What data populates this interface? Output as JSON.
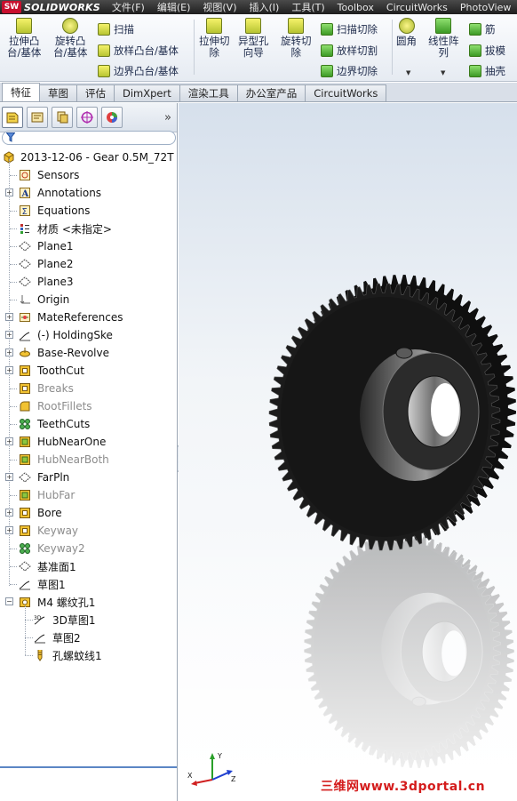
{
  "app": {
    "logo_mark": "SW",
    "logo_text": "SOLIDWORKS"
  },
  "menu": [
    "文件(F)",
    "编辑(E)",
    "视图(V)",
    "插入(I)",
    "工具(T)",
    "Toolbox",
    "CircuitWorks",
    "PhotoView"
  ],
  "ribbon": {
    "extrude_boss": [
      "拉伸凸",
      "台/基体"
    ],
    "revolve_boss": [
      "旋转凸",
      "台/基体"
    ],
    "sweep": "扫描",
    "loft_boss": "放样凸台/基体",
    "boundary_boss": "边界凸台/基体",
    "extrude_cut": [
      "拉伸切",
      "除"
    ],
    "hole_wizard": [
      "异型孔",
      "向导"
    ],
    "revolve_cut": [
      "旋转切",
      "除"
    ],
    "swept_cut": "扫描切除",
    "lofted_cut": "放样切割",
    "boundary_cut": "边界切除",
    "fillet": "圆角",
    "linear_pattern": [
      "线性阵",
      "列"
    ],
    "rib": "筋",
    "draft": "拔模",
    "shell": "抽壳"
  },
  "tabs": [
    "特征",
    "草图",
    "评估",
    "DimXpert",
    "渲染工具",
    "办公室产品",
    "CircuitWorks"
  ],
  "active_tab": "特征",
  "panel": {
    "more": "»"
  },
  "tree": {
    "root": "2013-12-06 - Gear 0.5M_72T",
    "items": [
      {
        "label": "Sensors",
        "icon": "sensor-icon",
        "dim": false
      },
      {
        "label": "Annotations",
        "icon": "annotation-icon",
        "dim": false
      },
      {
        "label": "Equations",
        "icon": "equation-icon",
        "dim": false
      },
      {
        "label": "材质 <未指定>",
        "icon": "material-icon",
        "dim": false
      },
      {
        "label": "Plane1",
        "icon": "plane-icon",
        "dim": false
      },
      {
        "label": "Plane2",
        "icon": "plane-icon",
        "dim": false
      },
      {
        "label": "Plane3",
        "icon": "plane-icon",
        "dim": false
      },
      {
        "label": "Origin",
        "icon": "origin-icon",
        "dim": false
      },
      {
        "label": "MateReferences",
        "icon": "mate-reference-icon",
        "dim": false
      },
      {
        "label": "(-) HoldingSke",
        "icon": "sketch-icon",
        "dim": false
      },
      {
        "label": "Base-Revolve",
        "icon": "revolve-icon",
        "dim": false
      },
      {
        "label": "ToothCut",
        "icon": "cut-icon",
        "dim": false
      },
      {
        "label": "Breaks",
        "icon": "cut-icon",
        "dim": true
      },
      {
        "label": "RootFillets",
        "icon": "fillet-icon",
        "dim": true
      },
      {
        "label": "TeethCuts",
        "icon": "pattern-icon",
        "dim": false
      },
      {
        "label": "HubNearOne",
        "icon": "boss-icon",
        "dim": false
      },
      {
        "label": "HubNearBoth",
        "icon": "boss-icon",
        "dim": true
      },
      {
        "label": "FarPln",
        "icon": "plane-icon",
        "dim": false
      },
      {
        "label": "HubFar",
        "icon": "boss-icon",
        "dim": true
      },
      {
        "label": "Bore",
        "icon": "cut-icon",
        "dim": false
      },
      {
        "label": "Keyway",
        "icon": "cut-icon",
        "dim": true
      },
      {
        "label": "Keyway2",
        "icon": "pattern-icon",
        "dim": true
      },
      {
        "label": "基准面1",
        "icon": "plane-icon",
        "dim": false
      },
      {
        "label": "草图1",
        "icon": "sketch-icon",
        "dim": false
      },
      {
        "label": "M4 螺纹孔1",
        "icon": "hole-icon",
        "dim": false
      },
      {
        "label": "3D草图1",
        "icon": "sketch-3d-icon",
        "dim": false
      },
      {
        "label": "草图2",
        "icon": "sketch-icon",
        "dim": false
      },
      {
        "label": "孔螺蚊线1",
        "icon": "thread-icon",
        "dim": false
      }
    ]
  },
  "viewport": {
    "watermark": "三维网www.3dportal.cn",
    "triad_labels": [
      "X",
      "Y",
      "Z"
    ]
  },
  "colors": {
    "accent_blue": "#5b86c4",
    "watermark_red": "#d41c1c",
    "gear_dark": "#1b1b1b"
  }
}
